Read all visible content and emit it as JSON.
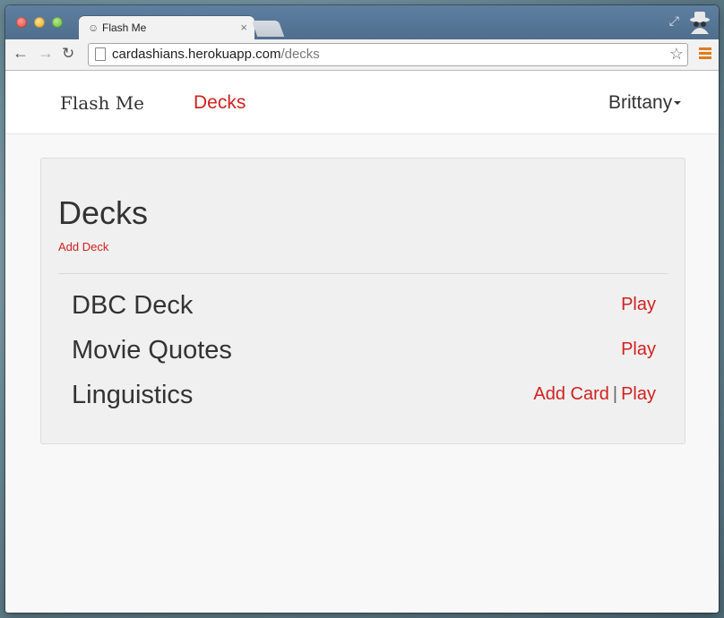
{
  "browser": {
    "tab_title": "Flash Me",
    "tab_close": "×",
    "url_host": "cardashians.herokuapp.com",
    "url_path": "/decks",
    "back_glyph": "←",
    "forward_glyph": "→",
    "reload_glyph": "↻",
    "star_glyph": "☆",
    "favicon_glyph": "☺",
    "icons": [
      "back-icon",
      "forward-icon",
      "reload-icon",
      "star-icon",
      "menu-icon",
      "incognito-icon",
      "resize-icon"
    ]
  },
  "navbar": {
    "brand": "Flash Me",
    "decks_link": "Decks",
    "user_name": "Brittany"
  },
  "main": {
    "heading": "Decks",
    "add_deck": "Add Deck",
    "decks": [
      {
        "name": "DBC Deck",
        "add_card": "",
        "play": "Play"
      },
      {
        "name": "Movie Quotes",
        "add_card": "",
        "play": "Play"
      },
      {
        "name": "Linguistics",
        "add_card": "Add Card",
        "play": "Play"
      }
    ]
  },
  "colors": {
    "accent": "#d0211f",
    "text": "#333333",
    "panel_bg": "#f0f0f0"
  }
}
